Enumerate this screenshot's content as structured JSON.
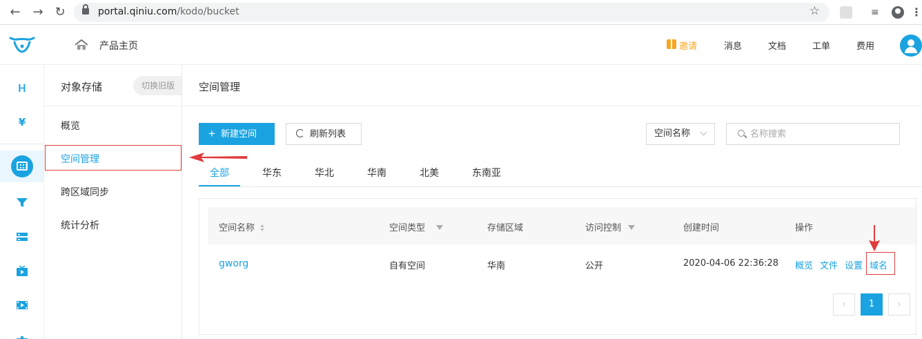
{
  "browser": {
    "url_host": "portal.qiniu.com",
    "url_path": "/kodo/bucket"
  },
  "header": {
    "home_label": "产品主页",
    "invite_label": "邀请",
    "nav": [
      "消息",
      "文档",
      "工单",
      "费用"
    ]
  },
  "sidebar": {
    "title": "对象存储",
    "switch_label": "切换旧版",
    "items": [
      "概览",
      "空间管理",
      "跨区域同步",
      "统计分析"
    ],
    "active_index": 1
  },
  "main": {
    "title": "空间管理",
    "new_button": "新建空间",
    "refresh_button": "刷新列表",
    "filter_select": "空间名称",
    "search_placeholder": "名称搜索",
    "tabs": [
      "全部",
      "华东",
      "华北",
      "华南",
      "北美",
      "东南亚"
    ],
    "active_tab": 0
  },
  "table": {
    "columns": [
      "空间名称",
      "空间类型",
      "存储区域",
      "访问控制",
      "创建时间",
      "操作"
    ],
    "rows": [
      {
        "name": "gworg",
        "type": "自有空间",
        "region": "华南",
        "access": "公开",
        "created": "2020-04-06 22:36:28",
        "ops": [
          "概览",
          "文件",
          "设置",
          "域名"
        ]
      }
    ]
  },
  "pagination": {
    "current": "1",
    "prev": "‹",
    "next": "›"
  },
  "colors": {
    "accent": "#1aa3e0",
    "highlight": "#e03c3c",
    "invite": "#f6a623"
  }
}
